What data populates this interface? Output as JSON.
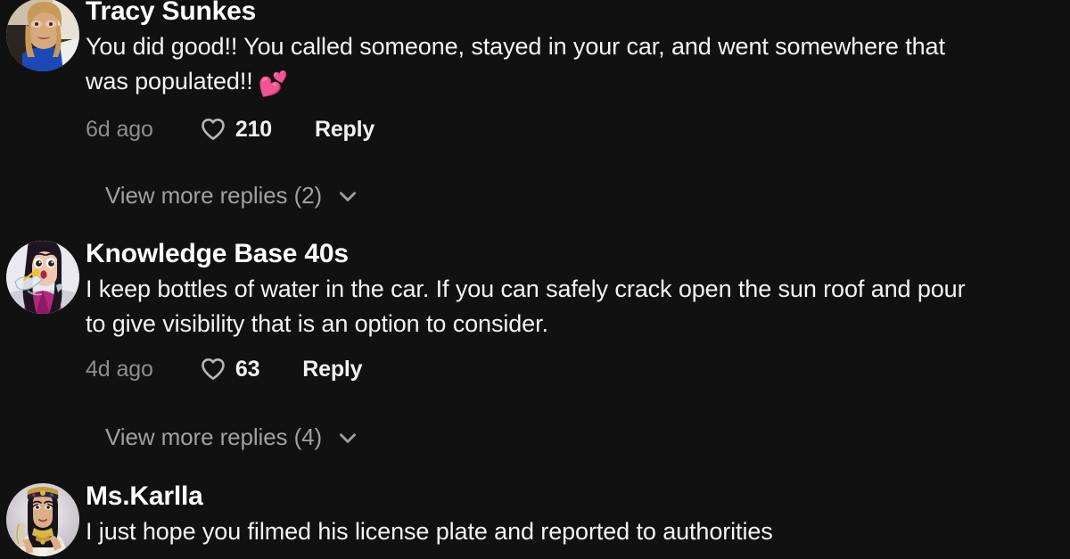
{
  "theme": {
    "background": "#111111",
    "username_color": "#ffffff",
    "text_color": "#f4f4f4",
    "muted_color": "#8e8e8e",
    "view_more_color": "#a0a0a0",
    "heart_outline_color": "#b5b5b5",
    "emoji_heart_color": "#f0366b"
  },
  "comments": [
    {
      "username": "Tracy Sunkes",
      "text": "You did good!! You called someone, stayed in your car, and went somewhere that was populated!!",
      "emoji": "💕",
      "emoji_name": "two-hearts-emoji",
      "timestamp": "6d ago",
      "like_count": "210",
      "reply_label": "Reply",
      "avatar_name": "avatar-tracy-sunkes",
      "avatar_description": "photo of blonde woman in blue shirt"
    },
    {
      "username": "Knowledge Base 40s",
      "text": "I keep bottles of water in the car. If you can safely crack open the sun roof and pour to give visibility that is an option to consider.",
      "emoji": "",
      "emoji_name": "",
      "timestamp": "4d ago",
      "like_count": "63",
      "reply_label": "Reply",
      "avatar_name": "avatar-knowledge-base-40s",
      "avatar_description": "illustration of dark haired woman in magenta top drinking from a bottle"
    },
    {
      "username": "Ms.Karlla",
      "text": "I just hope you filmed his license plate and reported to authorities",
      "emoji": "",
      "emoji_name": "",
      "timestamp": "",
      "like_count": "",
      "reply_label": "",
      "avatar_name": "avatar-ms-karlla",
      "avatar_description": "illustration of woman in egyptian cleopatra costume with gold jewelry"
    }
  ],
  "view_more": [
    {
      "label": "View more replies (2)",
      "count": "2"
    },
    {
      "label": "View more replies (4)",
      "count": "4"
    }
  ]
}
